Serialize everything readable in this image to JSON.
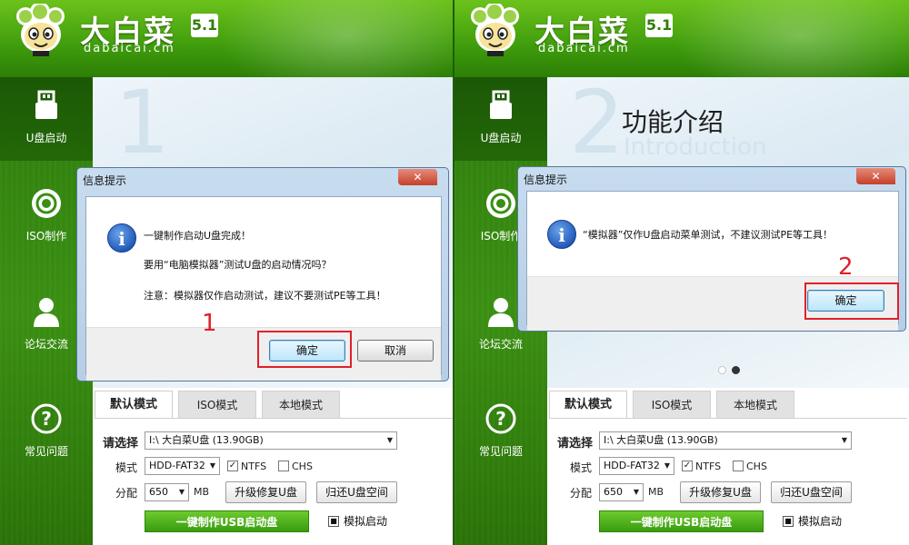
{
  "brand": {
    "name_cn": "大白菜",
    "version": "5.1",
    "domain": "dabaicai.cm"
  },
  "sidebar": [
    {
      "label": "U盘启动",
      "icon": "usb-drive-icon"
    },
    {
      "label": "ISO制作",
      "icon": "disc-icon"
    },
    {
      "label": "论坛交流",
      "icon": "user-icon"
    },
    {
      "label": "常见问题",
      "icon": "question-icon"
    }
  ],
  "form": {
    "tabs": [
      "默认模式",
      "ISO模式",
      "本地模式"
    ],
    "select_label": "请选择",
    "drive_value": "I:\\ 大白菜U盘 (13.90GB)",
    "mode_label": "模式",
    "mode_value": "HDD-FAT32",
    "ntfs_label": "NTFS",
    "chs_label": "CHS",
    "alloc_label": "分配",
    "alloc_value": "650",
    "alloc_unit": "MB",
    "upgrade_button": "升级修复U盘",
    "restore_button": "归还U盘空间",
    "make_button": "一键制作USB启动盘",
    "simulate_label": "模拟启动"
  },
  "left": {
    "bg_number": "1",
    "dialog": {
      "title": "信息提示",
      "line1": "一键制作启动U盘完成！",
      "line2": "要用“电脑模拟器”测试U盘的启动情况吗？",
      "line3": "注意：模拟器仅作启动测试，建议不要测试PE等工具！",
      "ok": "确定",
      "cancel": "取消"
    },
    "step": "1"
  },
  "right": {
    "bg_number": "2",
    "feature_title": "功能介绍",
    "feature_subtitle": "Introduction",
    "dialog": {
      "title": "信息提示",
      "line1": "“模拟器”仅作U盘启动菜单测试，不建议测试PE等工具！",
      "ok": "确定"
    },
    "step": "2"
  },
  "colors": {
    "brand_green": "#3f9c0c",
    "highlight_red": "#e0202a",
    "dialog_blue": "#b6cfe7"
  }
}
